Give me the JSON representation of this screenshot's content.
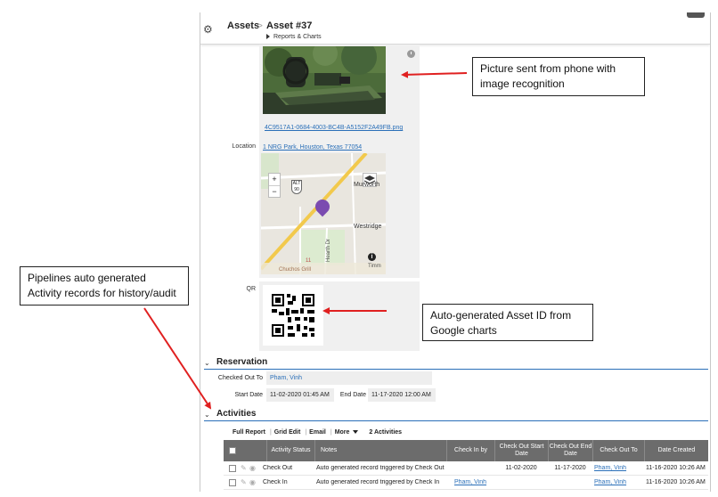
{
  "header": {
    "breadcrumb_root": "Assets",
    "breadcrumb_separator": ">",
    "title": "Asset #37",
    "subnav": "Reports & Charts"
  },
  "picture": {
    "file_link": "4C9517A1-0684-4003-BC4B-A5152F2A49FB.png"
  },
  "location": {
    "label": "Location",
    "address": "1 NRG Park, Houston, Texas 77054",
    "map": {
      "zoom_in": "+",
      "zoom_out": "−",
      "route_shield_top": "ALT",
      "route_shield_num": "90",
      "street_1": "Murworth",
      "street_2": "Westridge",
      "street_3": "Hearth Dr",
      "street_4": "Timm",
      "place": "Chuchos Grill",
      "poi": "11",
      "info": "i"
    }
  },
  "qr": {
    "label": "QR"
  },
  "reservation": {
    "title": "Reservation",
    "checked_out_to_label": "Checked Out To",
    "checked_out_to": "Pham, Vinh",
    "start_date_label": "Start Date",
    "start_date": "11-02-2020 01:45 AM",
    "end_date_label": "End Date",
    "end_date": "11-17-2020 12:00 AM"
  },
  "activities": {
    "title": "Activities",
    "toolbar": {
      "full_report": "Full Report",
      "grid_edit": "Grid Edit",
      "email": "Email",
      "more": "More",
      "count": "2 Activities"
    },
    "columns": [
      "Activity Status",
      "Notes",
      "Check In by",
      "Check Out Start Date",
      "Check Out End Date",
      "Check Out To",
      "Date Created"
    ],
    "rows": [
      {
        "status": "Check Out",
        "notes": "Auto generated record triggered by Check  Out",
        "check_in_by": "",
        "start": "11-02-2020",
        "end": "11-17-2020",
        "to": "Pham, Vinh",
        "created": "11-16-2020 10:26 AM"
      },
      {
        "status": "Check In",
        "notes": "Auto generated record triggered by Check  In",
        "check_in_by": "Pham, Vinh",
        "start": "",
        "end": "",
        "to": "Pham, Vinh",
        "created": "11-16-2020 10:26 AM"
      }
    ]
  },
  "annotations": {
    "picture": "Picture sent from phone with image recognition",
    "pipelines": "Pipelines auto generated Activity records for history/audit",
    "qr": "Auto-generated Asset ID from Google charts"
  },
  "colors": {
    "link": "#2a6fb8",
    "arrow": "#e02020",
    "grid_header": "#6c6c6c",
    "map_marker": "#7b4bb0"
  }
}
